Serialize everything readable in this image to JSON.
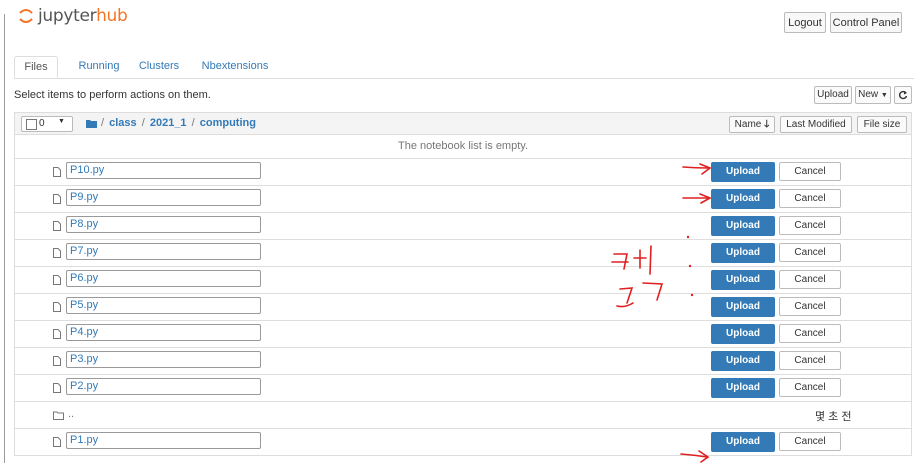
{
  "app": {
    "logo_main": "jupyter",
    "logo_hub": "hub",
    "brand_color": "#f37626"
  },
  "header": {
    "logout_label": "Logout",
    "control_panel_label": "Control Panel"
  },
  "tabs": [
    {
      "label": "Files",
      "active": true
    },
    {
      "label": "Running",
      "active": false
    },
    {
      "label": "Clusters",
      "active": false
    },
    {
      "label": "Nbextensions",
      "active": false
    }
  ],
  "toolbar": {
    "instructions": "Select items to perform actions on them.",
    "upload_label": "Upload",
    "new_label": "New",
    "refresh_icon": "refresh-icon"
  },
  "list_header": {
    "selected_count": "0",
    "breadcrumb": [
      "class",
      "2021_1",
      "computing"
    ],
    "sort_name_label": "Name",
    "sort_modified_label": "Last Modified",
    "sort_size_label": "File size"
  },
  "empty_message": "The notebook list is empty.",
  "upload_rows_top": [
    {
      "filename": "P10.py",
      "upload_label": "Upload",
      "cancel_label": "Cancel"
    },
    {
      "filename": "P9.py",
      "upload_label": "Upload",
      "cancel_label": "Cancel"
    },
    {
      "filename": "P8.py",
      "upload_label": "Upload",
      "cancel_label": "Cancel"
    },
    {
      "filename": "P7.py",
      "upload_label": "Upload",
      "cancel_label": "Cancel"
    },
    {
      "filename": "P6.py",
      "upload_label": "Upload",
      "cancel_label": "Cancel"
    },
    {
      "filename": "P5.py",
      "upload_label": "Upload",
      "cancel_label": "Cancel"
    },
    {
      "filename": "P4.py",
      "upload_label": "Upload",
      "cancel_label": "Cancel"
    },
    {
      "filename": "P3.py",
      "upload_label": "Upload",
      "cancel_label": "Cancel"
    },
    {
      "filename": "P2.py",
      "upload_label": "Upload",
      "cancel_label": "Cancel"
    }
  ],
  "parent_row": {
    "name": "..",
    "modified": "몇 초 전"
  },
  "upload_row_bottom": {
    "filename": "P1.py",
    "upload_label": "Upload",
    "cancel_label": "Cancel"
  },
  "colors": {
    "primary": "#337ab7",
    "annotation": "#e02020"
  }
}
